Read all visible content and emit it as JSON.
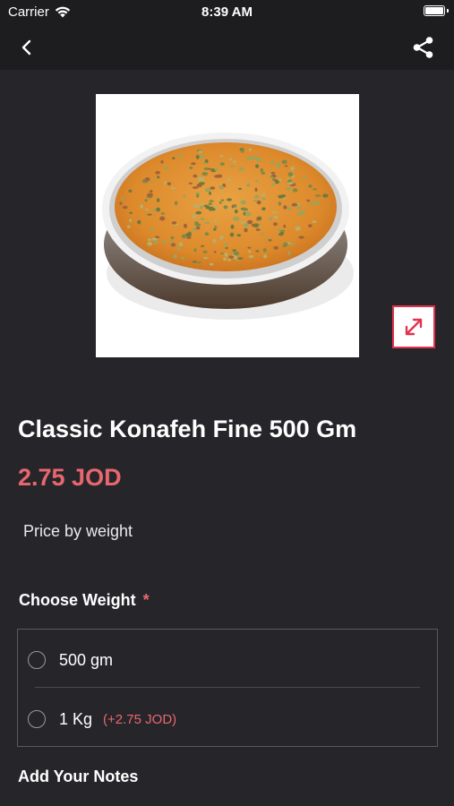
{
  "status_bar": {
    "carrier": "Carrier",
    "time": "8:39 AM"
  },
  "nav": {
    "back_icon": "chevron-left-icon",
    "share_icon": "share-icon"
  },
  "product": {
    "image_subject": "Konafeh tray with pistachios",
    "expand_icon": "expand-arrows-icon",
    "title": "Classic Konafeh Fine 500 Gm",
    "price": "2.75 JOD",
    "price_note": "Price by weight"
  },
  "weight_section": {
    "title": "Choose Weight",
    "required_mark": "*",
    "options": [
      {
        "label": "500 gm",
        "extra": ""
      },
      {
        "label": "1 Kg",
        "extra": "(+2.75 JOD)"
      }
    ]
  },
  "notes_section": {
    "title": "Add Your Notes"
  },
  "colors": {
    "background": "#26262a",
    "bar": "#1d1d20",
    "accent": "#e8676f",
    "expand_border": "#e2334e"
  }
}
